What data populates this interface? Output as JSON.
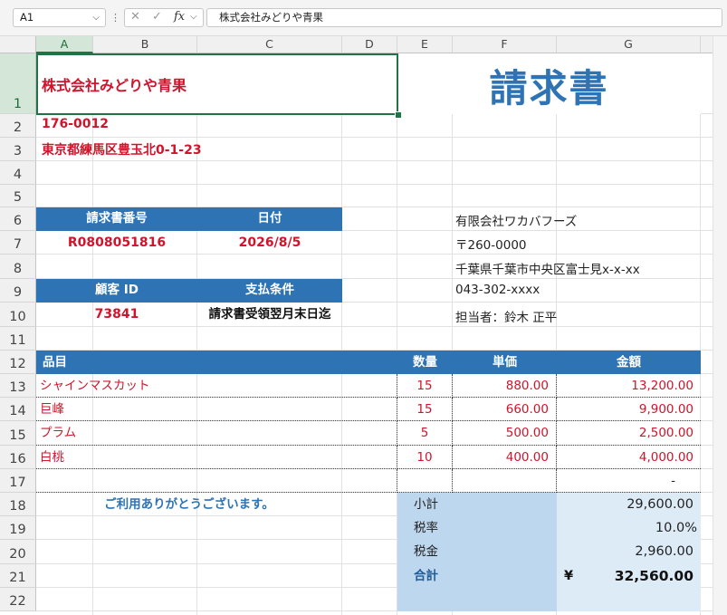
{
  "formula_bar": {
    "name_box": "A1",
    "fx": "fx",
    "content": "株式会社みどりや青果"
  },
  "columns": [
    "A",
    "B",
    "C",
    "D",
    "E",
    "F",
    "G"
  ],
  "rows": [
    "1",
    "2",
    "3",
    "4",
    "5",
    "6",
    "7",
    "8",
    "9",
    "10",
    "11",
    "12",
    "13",
    "14",
    "15",
    "16",
    "17",
    "18",
    "19",
    "20",
    "21",
    "22"
  ],
  "company": {
    "name": "株式会社みどりや青果",
    "zip": "176-0012",
    "address": "東京都練馬区豊玉北0-1-23"
  },
  "title": "請求書",
  "invoice_info": {
    "header_no": "請求書番号",
    "header_date": "日付",
    "invoice_no": "R0808051816",
    "date": "2026/8/5",
    "header_customer": "顧客 ID",
    "header_terms": "支払条件",
    "customer_id": "73841",
    "terms": "請求書受領翌月末日迄"
  },
  "recipient": {
    "name": "有限会社ワカバフーズ",
    "zip": "〒260-0000",
    "address": "千葉県千葉市中央区富士見x-x-xx",
    "phone": "043-302-xxxx",
    "contact": "担当者：鈴木 正平"
  },
  "items_table": {
    "headers": {
      "item": "品目",
      "qty": "数量",
      "price": "単価",
      "amount": "金額"
    },
    "rows": [
      {
        "item": "シャインマスカット",
        "qty": "15",
        "price": "880.00",
        "amount": "13,200.00"
      },
      {
        "item": "巨峰",
        "qty": "15",
        "price": "660.00",
        "amount": "9,900.00"
      },
      {
        "item": "プラム",
        "qty": "5",
        "price": "500.00",
        "amount": "2,500.00"
      },
      {
        "item": "白桃",
        "qty": "10",
        "price": "400.00",
        "amount": "4,000.00"
      },
      {
        "item": "",
        "qty": "",
        "price": "",
        "amount": "-"
      }
    ]
  },
  "thanks": "ご利用ありがとうございます。",
  "totals": {
    "subtotal_label": "小計",
    "subtotal": "29,600.00",
    "tax_rate_label": "税率",
    "tax_rate": "10.0%",
    "tax_label": "税金",
    "tax": "2,960.00",
    "total_label": "合計",
    "currency": "¥",
    "total": "32,560.00"
  },
  "colors": {
    "accent_blue": "#2e74b5",
    "light_blue": "#bdd7ee",
    "lighter_blue": "#ddebf7",
    "red": "#d0142b",
    "excel_green": "#217346"
  }
}
